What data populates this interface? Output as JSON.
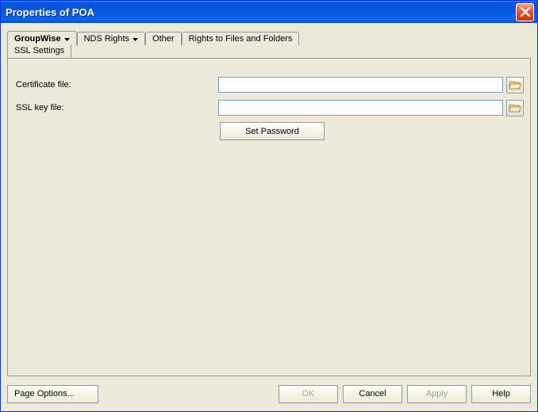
{
  "window": {
    "title": "Properties of POA"
  },
  "tabs": {
    "groupwise": "GroupWise",
    "groupwise_sub": "SSL Settings",
    "nds_rights": "NDS Rights",
    "other": "Other",
    "rights_files": "Rights to Files and Folders"
  },
  "form": {
    "cert_label": "Certificate file:",
    "cert_value": "",
    "key_label": "SSL key file:",
    "key_value": "",
    "set_password": "Set Password"
  },
  "footer": {
    "page_options": "Page Options...",
    "ok": "OK",
    "cancel": "Cancel",
    "apply": "Apply",
    "help": "Help"
  }
}
